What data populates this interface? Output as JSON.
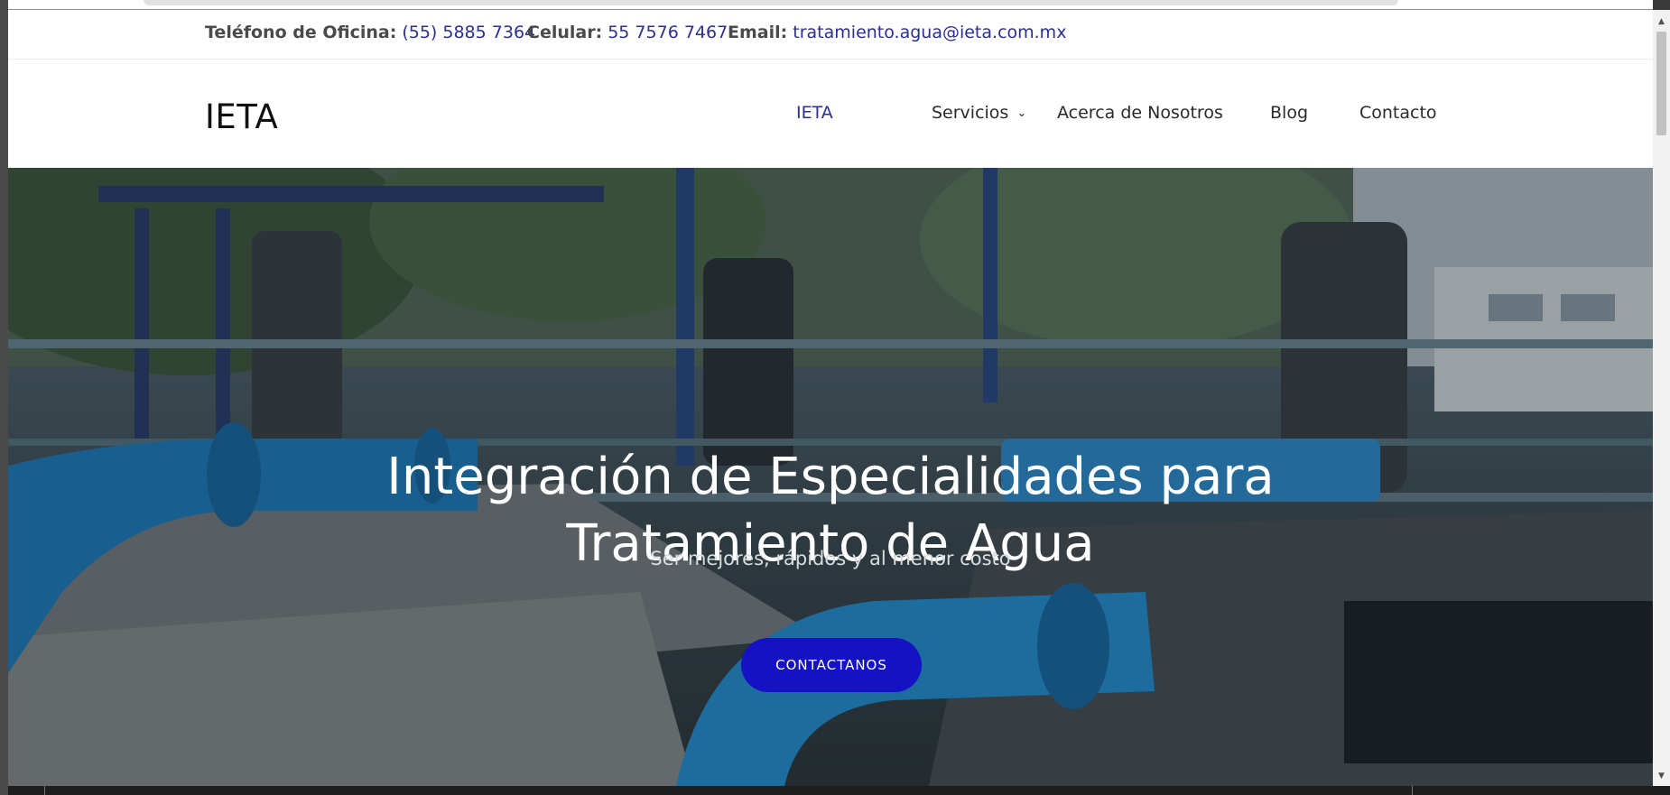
{
  "topbar": {
    "office_label": "Teléfono de Oficina:",
    "office_value": "(55) 5885 7364",
    "cell_label": "Celular:",
    "cell_value": "55 7576 7467",
    "email_label": "Email:",
    "email_value": "tratamiento.agua@ieta.com.mx"
  },
  "header": {
    "logo": "IETA",
    "nav": [
      {
        "label": "IETA",
        "active": true
      },
      {
        "label": "Servicios",
        "has_dropdown": true
      },
      {
        "label": "Acerca de Nosotros"
      },
      {
        "label": "Blog"
      },
      {
        "label": "Contacto"
      }
    ],
    "chevron_icon": "chevron-down-icon"
  },
  "hero": {
    "title_line1": "Integración de Especialidades para",
    "title_line2": "Tratamiento de Agua",
    "subtitle": "Ser mejores, rápidos y al menor costo",
    "button_label": "CONTACTANOS",
    "image_subject": "blue water pipes and pumps at treatment plant"
  },
  "colors": {
    "link": "#2b2f8f",
    "button": "#1511c4",
    "pipe_blue": "#1f7fc0"
  },
  "scrollbar": {
    "up_icon": "arrow-up-icon",
    "down_icon": "arrow-down-icon"
  }
}
